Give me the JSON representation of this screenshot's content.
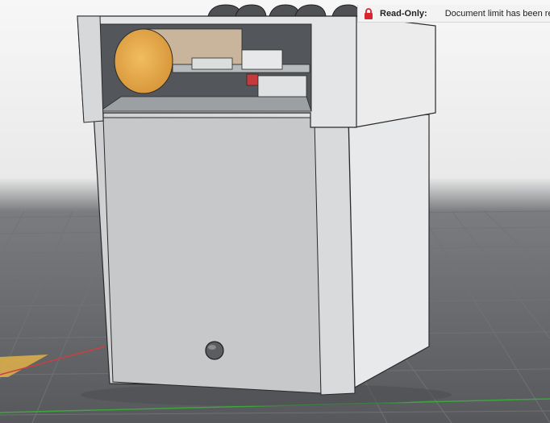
{
  "notification": {
    "label": "Read-Only:",
    "message": "Document limit has been rea",
    "icon": "lock-icon",
    "icon_color": "#d9262e"
  },
  "viewport": {
    "background": "#5e6063",
    "model_color": "#d2d3d4",
    "grid_color": "#6c6e71",
    "axis_x_color": "#c84040",
    "axis_y_color": "#3da63d",
    "cylinder_color": "#e3a84a"
  }
}
